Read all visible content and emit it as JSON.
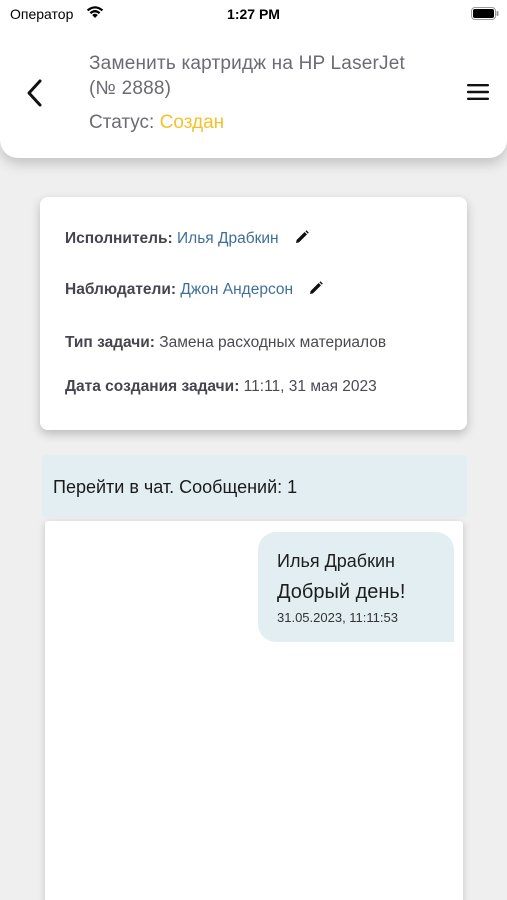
{
  "status_bar": {
    "carrier": "Оператор",
    "time": "1:27 PM"
  },
  "header": {
    "title": "Заменить картридж на HP LaserJet (№ 2888)",
    "status_label": "Статус:",
    "status_value": "Создан",
    "status_color": "#f3c22a",
    "back_icon": "chevron-left-icon",
    "menu_icon": "hamburger-menu-icon"
  },
  "info": {
    "assignee_label": "Исполнитель:",
    "assignee_value": "Илья Драбкин",
    "observers_label": "Наблюдатели:",
    "observers_value": "Джон Андерсон",
    "task_type_label": "Тип задачи:",
    "task_type_value": "Замена расходных материалов",
    "created_label": "Дата создания задачи:",
    "created_value": "11:11, 31 мая 2023",
    "link_color": "#3e6f98"
  },
  "chat": {
    "link_text": "Перейти в чат. Сообщений: 1",
    "messages": [
      {
        "author": "Илья Драбкин",
        "text": "Добрый день!",
        "time": "31.05.2023, 11:11:53"
      }
    ]
  }
}
